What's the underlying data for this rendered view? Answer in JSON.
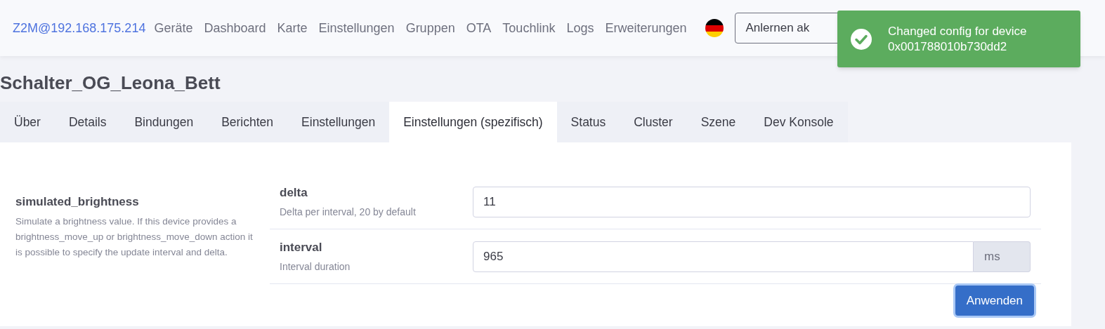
{
  "navbar": {
    "brand": "Z2M@192.168.175.214",
    "links": [
      "Geräte",
      "Dashboard",
      "Karte",
      "Einstellungen",
      "Gruppen",
      "OTA",
      "Touchlink",
      "Logs",
      "Erweiterungen"
    ],
    "permit_join": "Anlernen ak"
  },
  "toast": {
    "message": "Changed config for device 0x001788010b730dd2"
  },
  "device_title": "Schalter_OG_Leona_Bett",
  "tabs": [
    {
      "label": "Über",
      "selected": false
    },
    {
      "label": "Details",
      "selected": false
    },
    {
      "label": "Bindungen",
      "selected": false
    },
    {
      "label": "Berichten",
      "selected": false
    },
    {
      "label": "Einstellungen",
      "selected": false
    },
    {
      "label": "Einstellungen (spezifisch)",
      "selected": true
    },
    {
      "label": "Status",
      "selected": false
    },
    {
      "label": "Cluster",
      "selected": false
    },
    {
      "label": "Szene",
      "selected": false
    },
    {
      "label": "Dev Konsole",
      "selected": false
    }
  ],
  "setting": {
    "name": "simulated_brightness",
    "description": "Simulate a brightness value. If this device provides a brightness_move_up or brightness_move_down action it is possible to specify the update interval and delta.",
    "fields": [
      {
        "name": "delta",
        "description": "Delta per interval, 20 by default",
        "value": "11"
      },
      {
        "name": "interval",
        "description": "Interval duration",
        "value": "965",
        "unit": "ms"
      }
    ],
    "apply_button": "Anwenden"
  }
}
